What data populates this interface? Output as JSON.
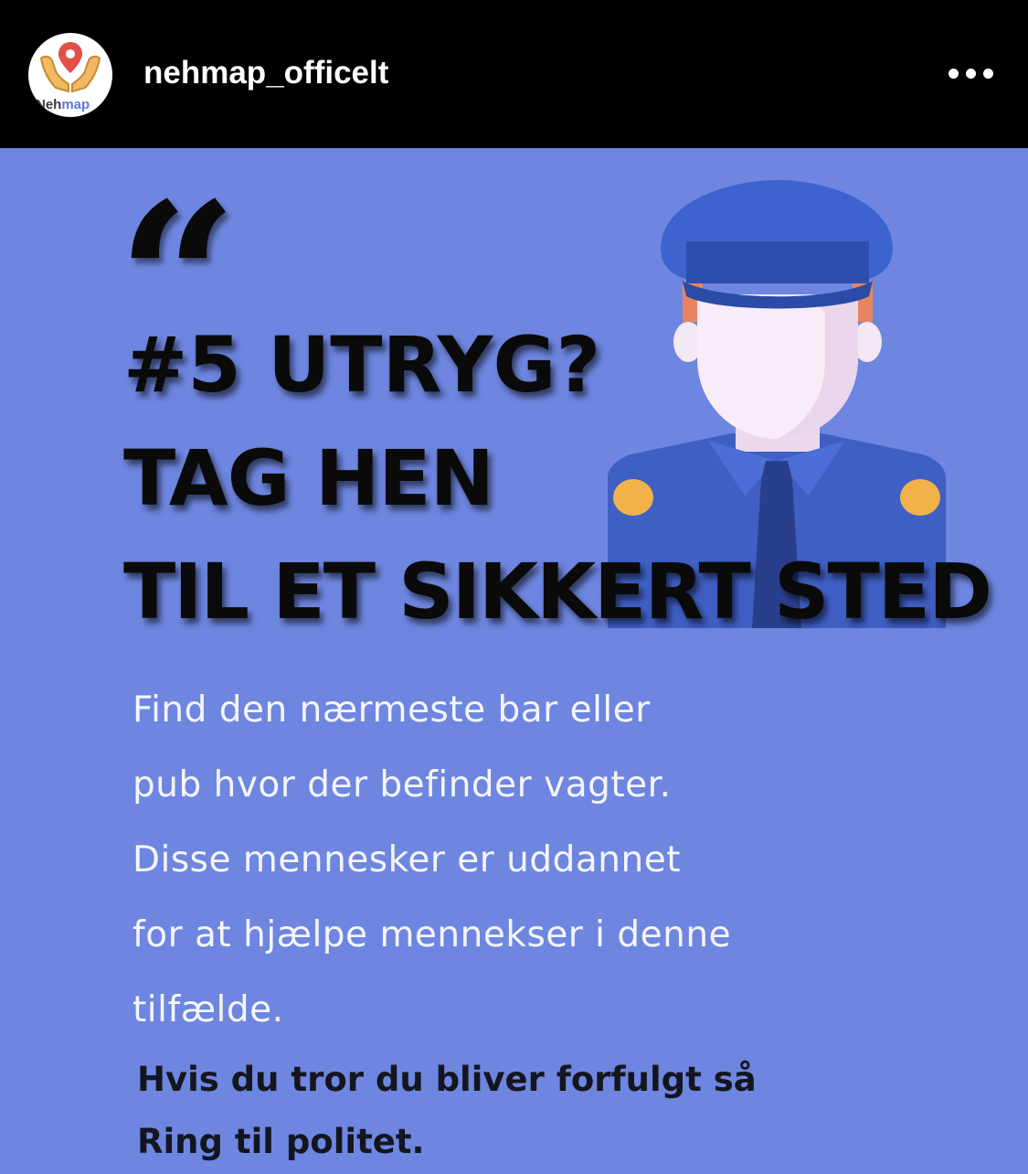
{
  "header": {
    "username": "nehmap_officelt",
    "more_icon": "more-horizontal-icon",
    "avatar": {
      "logo_text_prefix": "Neh",
      "logo_text_suffix": "map",
      "accent_color": "#5a7ad8",
      "hands_color": "#f2b865",
      "pin_color": "#e2504a"
    }
  },
  "post": {
    "background_color": "#6e86e0",
    "quote_mark": "“",
    "headline": [
      "#5 UTRYG?",
      "TAG HEN",
      "TIL ET SIKKERT STED"
    ],
    "body_lines": [
      "Find den nærmeste bar eller",
      "pub hvor der befinder vagter.",
      "Disse mennesker er uddannet",
      "for at hjælpe mennekser i denne",
      "tilfælde."
    ],
    "call_to_action": [
      "Hvis du tror du bliver forfulgt så",
      "Ring til politet."
    ],
    "illustration": "police-officer-icon"
  }
}
